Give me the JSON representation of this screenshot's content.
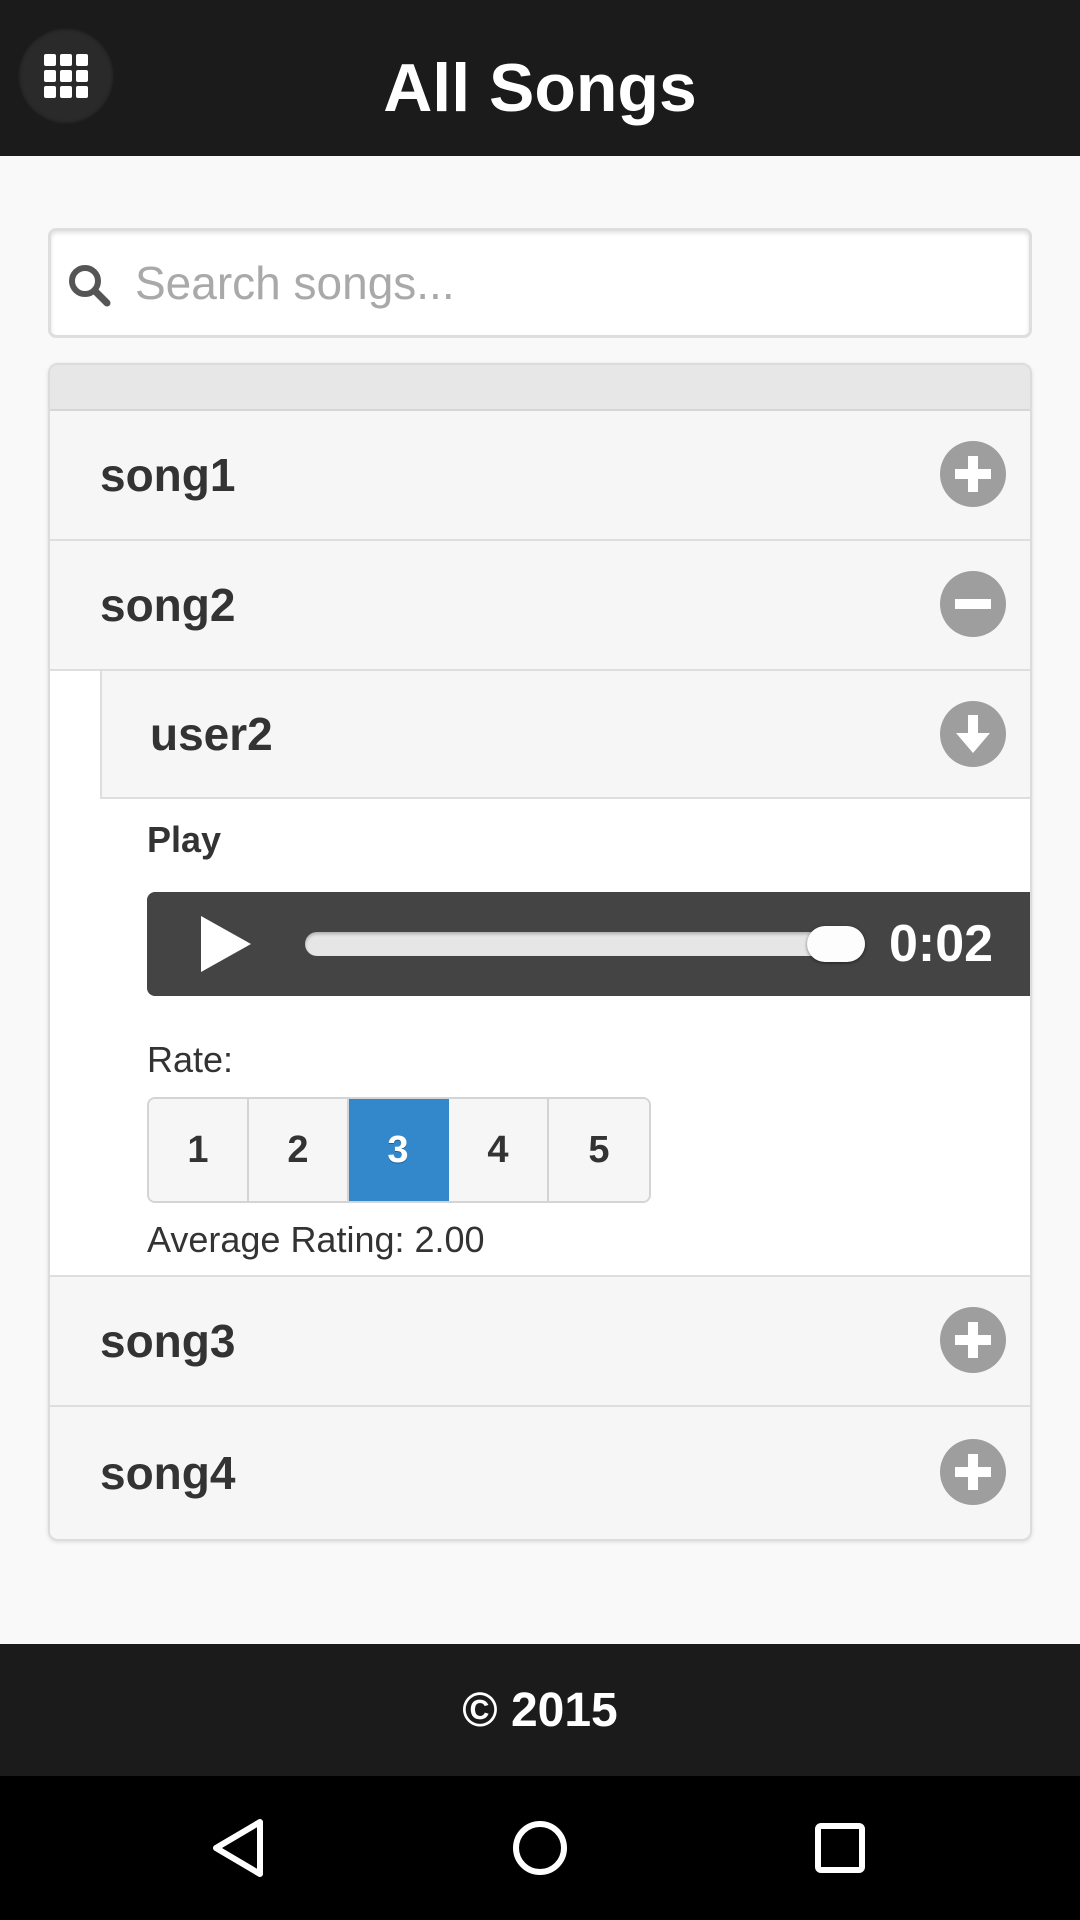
{
  "header": {
    "title": "All Songs",
    "menu_icon": "grid-icon"
  },
  "search": {
    "placeholder": "Search songs...",
    "value": ""
  },
  "songs": [
    {
      "label": "song1",
      "icon": "plus-icon",
      "expanded": false
    },
    {
      "label": "song2",
      "icon": "minus-icon",
      "expanded": true
    },
    {
      "label": "song3",
      "icon": "plus-icon",
      "expanded": false
    },
    {
      "label": "song4",
      "icon": "plus-icon",
      "expanded": false
    }
  ],
  "expanded_song": {
    "user": {
      "label": "user2",
      "icon": "download-icon"
    },
    "play_label": "Play",
    "player": {
      "time": "0:02",
      "progress": 0.95
    },
    "rate_label": "Rate:",
    "rate_options": [
      "1",
      "2",
      "3",
      "4",
      "5"
    ],
    "selected_rating": "3",
    "average_rating": "Average Rating: 2.00"
  },
  "footer": {
    "text": "© 2015"
  },
  "colors": {
    "header_bg": "#1b1b1b",
    "accent": "#3388cc",
    "icon_gray": "#9e9e9e"
  },
  "navbar": {
    "icons": [
      "back-icon",
      "home-icon",
      "recents-icon"
    ]
  }
}
